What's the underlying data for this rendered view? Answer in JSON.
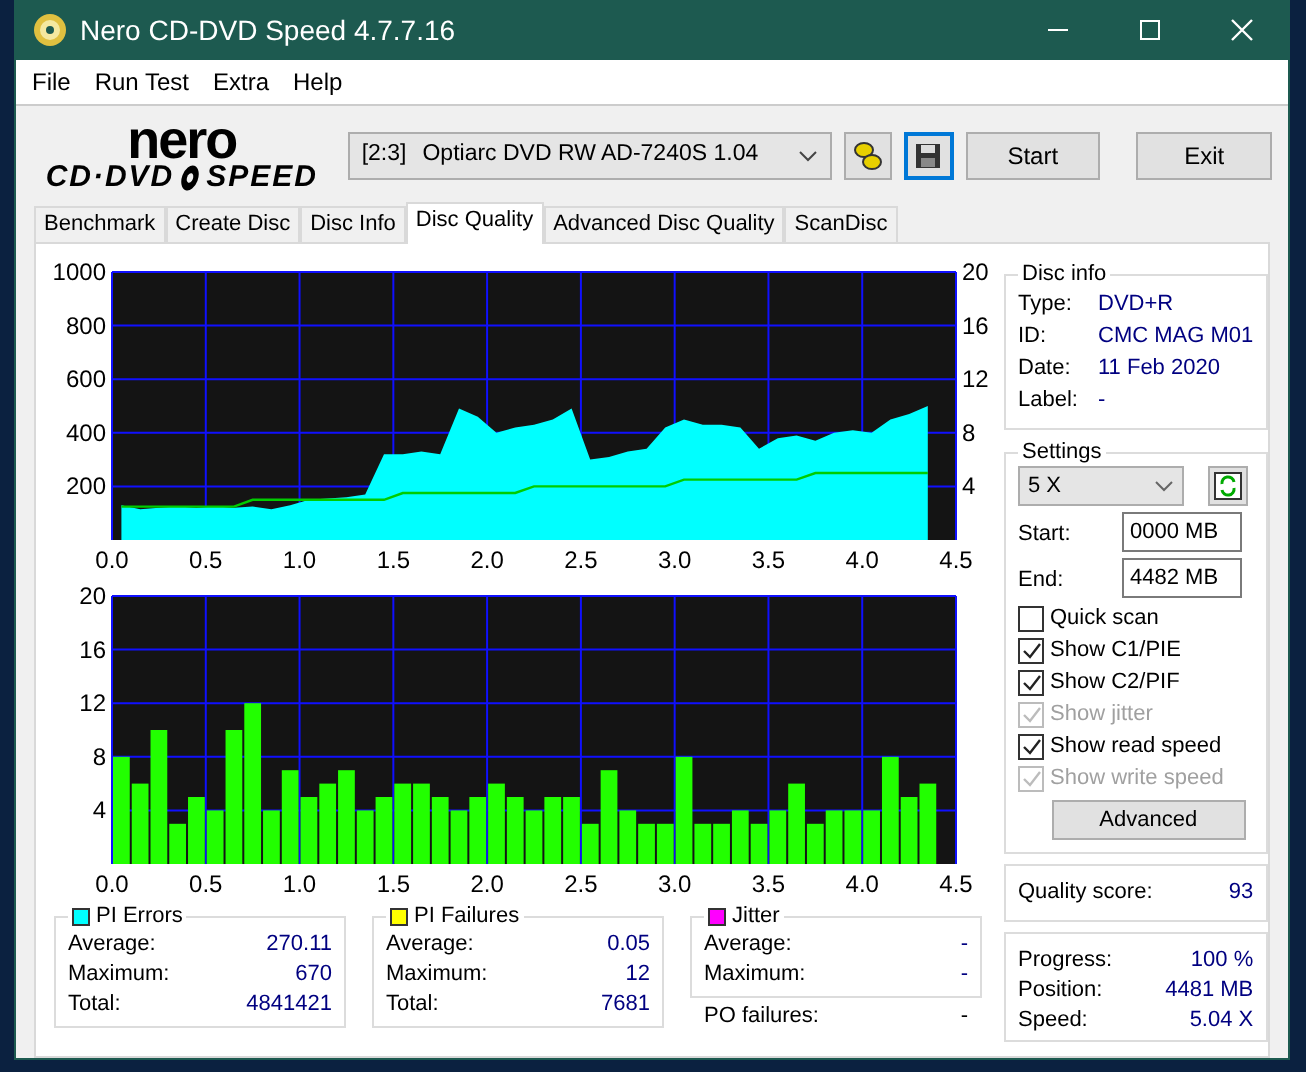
{
  "window": {
    "title": "Nero CD-DVD Speed 4.7.7.16"
  },
  "menu": [
    "File",
    "Run Test",
    "Extra",
    "Help"
  ],
  "logo": {
    "line_1": "nero",
    "line_2": "CD·DVD",
    "line_3": "SPEED"
  },
  "toolbar": {
    "drive_port": "[2:3]",
    "drive_name": "Optiarc DVD RW AD-7240S 1.04",
    "buttons": [
      "Start",
      "Exit"
    ]
  },
  "tabs": [
    {
      "label": "Benchmark",
      "selected": false
    },
    {
      "label": "Create Disc",
      "selected": false
    },
    {
      "label": "Disc Info",
      "selected": false
    },
    {
      "label": "Disc Quality",
      "selected": true
    },
    {
      "label": "Advanced Disc Quality",
      "selected": false
    },
    {
      "label": "ScanDisc",
      "selected": false
    }
  ],
  "charts": [
    {
      "chart_data": {
        "type": "area",
        "grid": true,
        "xlim": [
          0,
          4.5
        ],
        "ylim": [
          0,
          1000
        ],
        "xticks": [
          {
            "value": 0,
            "label": "0.0"
          },
          0.5,
          {
            "value": 1,
            "label": "1.0"
          },
          1.5,
          {
            "value": 2,
            "label": "2.0"
          },
          2.5,
          {
            "value": 3,
            "label": "3.0"
          },
          3.5,
          {
            "value": 4,
            "label": "4.0"
          },
          4.5
        ],
        "yticks": [
          200,
          400,
          600,
          800,
          1000
        ],
        "y2lim": [
          0,
          20
        ],
        "y2ticks": [
          4,
          8,
          12,
          16,
          20
        ],
        "x": [
          0.05,
          0.15,
          0.25,
          0.35,
          0.45,
          0.55,
          0.65,
          0.75,
          0.85,
          0.95,
          1.05,
          1.15,
          1.25,
          1.35,
          1.45,
          1.55,
          1.65,
          1.75,
          1.85,
          1.95,
          2.05,
          2.15,
          2.25,
          2.35,
          2.45,
          2.55,
          2.65,
          2.75,
          2.85,
          2.95,
          3.05,
          3.15,
          3.25,
          3.35,
          3.45,
          3.55,
          3.65,
          3.75,
          3.85,
          3.95,
          4.05,
          4.15,
          4.25,
          4.35
        ],
        "series": [
          {
            "color": "#00ffff",
            "values": [
              130,
              115,
              120,
              125,
              120,
              125,
              120,
              125,
              115,
              130,
              150,
              155,
              160,
              170,
              320,
              320,
              330,
              320,
              490,
              460,
              400,
              420,
              430,
              450,
              490,
              300,
              310,
              330,
              340,
              420,
              450,
              430,
              430,
              420,
              340,
              380,
              390,
              370,
              400,
              410,
              400,
              450,
              470,
              500
            ]
          },
          {
            "type": "line",
            "axis": "y2",
            "color": "#00cc00",
            "values": [
              2.5,
              2.5,
              2.5,
              2.5,
              2.5,
              2.5,
              2.5,
              3,
              3,
              3,
              3,
              3,
              3,
              3,
              3,
              3.5,
              3.5,
              3.5,
              3.5,
              3.5,
              3.5,
              3.5,
              4,
              4,
              4,
              4,
              4,
              4,
              4,
              4,
              4.5,
              4.5,
              4.5,
              4.5,
              4.5,
              4.5,
              4.5,
              5,
              5,
              5,
              5,
              5,
              5,
              5
            ]
          }
        ]
      }
    },
    {
      "chart_data": {
        "type": "bar",
        "grid": true,
        "xlim": [
          0,
          4.5
        ],
        "ylim": [
          0,
          20
        ],
        "xticks": [
          {
            "value": 0,
            "label": "0.0"
          },
          0.5,
          {
            "value": 1,
            "label": "1.0"
          },
          1.5,
          {
            "value": 2,
            "label": "2.0"
          },
          2.5,
          {
            "value": 3,
            "label": "3.0"
          },
          3.5,
          {
            "value": 4,
            "label": "4.0"
          },
          4.5
        ],
        "yticks": [
          4,
          8,
          12,
          16,
          20
        ],
        "x": [
          0.05,
          0.15,
          0.25,
          0.35,
          0.45,
          0.55,
          0.65,
          0.75,
          0.85,
          0.95,
          1.05,
          1.15,
          1.25,
          1.35,
          1.45,
          1.55,
          1.65,
          1.75,
          1.85,
          1.95,
          2.05,
          2.15,
          2.25,
          2.35,
          2.45,
          2.55,
          2.65,
          2.75,
          2.85,
          2.95,
          3.05,
          3.15,
          3.25,
          3.35,
          3.45,
          3.55,
          3.65,
          3.75,
          3.85,
          3.95,
          4.05,
          4.15,
          4.25,
          4.35
        ],
        "series": [
          {
            "color": "#22ff00",
            "values": [
              8,
              6,
              10,
              3,
              5,
              4,
              10,
              12,
              4,
              7,
              5,
              6,
              7,
              4,
              5,
              6,
              6,
              5,
              4,
              5,
              6,
              5,
              4,
              5,
              5,
              3,
              7,
              4,
              3,
              3,
              8,
              3,
              3,
              4,
              3,
              4,
              6,
              3,
              4,
              4,
              4,
              8,
              5,
              6
            ]
          }
        ]
      }
    }
  ],
  "disc_info": {
    "title": "Disc info",
    "rows": [
      {
        "label": "Type:",
        "value": "DVD+R"
      },
      {
        "label": "ID:",
        "value": "CMC MAG M01"
      },
      {
        "label": "Date:",
        "value": "11 Feb 2020"
      },
      {
        "label": "Label:",
        "value": "-"
      }
    ]
  },
  "settings": {
    "title": "Settings",
    "speed": "5 X",
    "start_label": "Start:",
    "start": "0000 MB",
    "end_label": "End:",
    "end": "4482 MB",
    "options": [
      {
        "label": "Quick scan",
        "checked": false,
        "disabled": false
      },
      {
        "label": "Show C1/PIE",
        "checked": true,
        "disabled": false
      },
      {
        "label": "Show C2/PIF",
        "checked": true,
        "disabled": false
      },
      {
        "label": "Show jitter",
        "checked": true,
        "disabled": true
      },
      {
        "label": "Show read speed",
        "checked": true,
        "disabled": false
      },
      {
        "label": "Show write speed",
        "checked": true,
        "disabled": true
      }
    ],
    "advanced": "Advanced"
  },
  "quality": {
    "label": "Quality score:",
    "value": "93"
  },
  "progress": [
    {
      "label": "Progress:",
      "value": "100 %"
    },
    {
      "label": "Position:",
      "value": "4481 MB"
    },
    {
      "label": "Speed:",
      "value": "5.04 X"
    }
  ],
  "stats": [
    {
      "title": "PI Errors",
      "color": "#00ffff",
      "rows": [
        {
          "label": "Average:",
          "value": "270.11"
        },
        {
          "label": "Maximum:",
          "value": "670"
        },
        {
          "label": "Total:",
          "value": "4841421"
        }
      ]
    },
    {
      "title": "PI Failures",
      "color": "#ffff00",
      "rows": [
        {
          "label": "Average:",
          "value": "0.05"
        },
        {
          "label": "Maximum:",
          "value": "12"
        },
        {
          "label": "Total:",
          "value": "7681"
        }
      ]
    },
    {
      "title": "Jitter",
      "color": "#ff00ff",
      "rows": [
        {
          "label": "Average:",
          "value": "-"
        },
        {
          "label": "Maximum:",
          "value": "-"
        }
      ]
    }
  ],
  "po_failures": {
    "label": "PO failures:",
    "value": "-"
  }
}
